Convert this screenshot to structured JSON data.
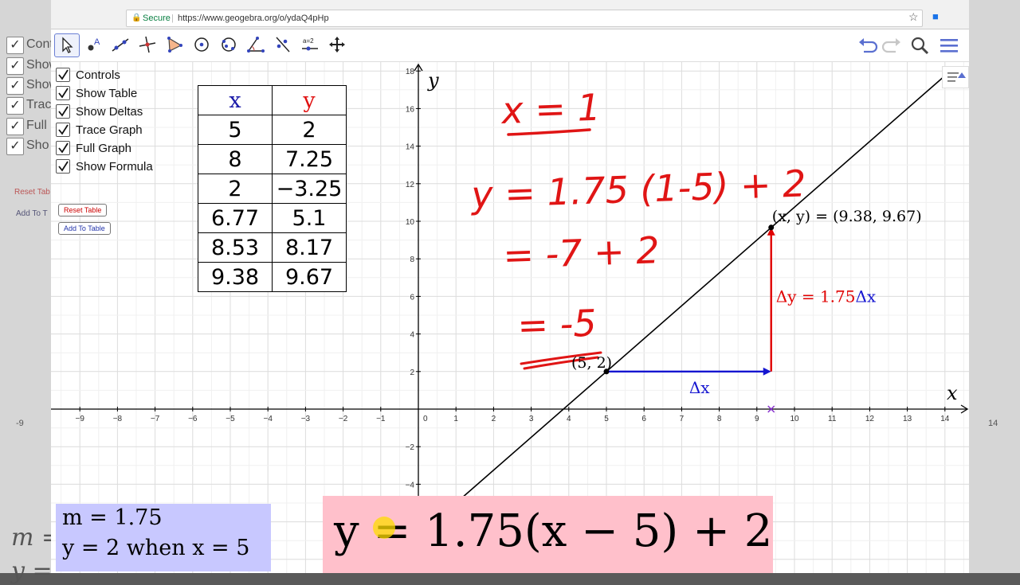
{
  "browser": {
    "secure_label": "Secure",
    "url": "https://www.geogebra.org/o/ydaQ4pHp"
  },
  "background": {
    "ghost_labels": [
      "Contro",
      "Show",
      "Show",
      "Trac",
      "Full",
      "Sho"
    ],
    "ghost_buttons": [
      "Reset Tab",
      "Add To T"
    ],
    "ghost_ticks": [
      "-9",
      "14"
    ],
    "ghost_letters": [
      "m =",
      "y ="
    ]
  },
  "controls": {
    "checkboxes": [
      {
        "label": "Controls",
        "checked": true
      },
      {
        "label": "Show Table",
        "checked": true
      },
      {
        "label": "Show Deltas",
        "checked": true
      },
      {
        "label": "Trace Graph",
        "checked": true
      },
      {
        "label": "Full Graph",
        "checked": true
      },
      {
        "label": "Show Formula",
        "checked": true
      }
    ],
    "reset_label": "Reset Table",
    "add_label": "Add To Table"
  },
  "table": {
    "headers": [
      "x",
      "y"
    ],
    "rows": [
      [
        "5",
        "2"
      ],
      [
        "8",
        "7.25"
      ],
      [
        "2",
        "−3.25"
      ],
      [
        "6.77",
        "5.1"
      ],
      [
        "8.53",
        "8.17"
      ],
      [
        "9.38",
        "9.67"
      ]
    ]
  },
  "info": {
    "line1": "m = 1.75",
    "line2": "y = 2 when x = 5"
  },
  "formula": "y = 1.75(x − 5) + 2",
  "graph": {
    "x_label": "x",
    "y_label": "y",
    "point_a_label": "(5, 2)",
    "point_b_label": "(x, y) = (9.38, 9.67)",
    "delta_y_prefix": "Δy = 1.75",
    "delta_y_suffix": "Δx",
    "delta_x_label": "Δx",
    "line": {
      "slope": 1.75,
      "x0": 5,
      "y0": 2
    },
    "point_a": [
      5,
      2
    ],
    "point_b": [
      9.38,
      9.67
    ],
    "x_ticks": [
      -9,
      -8,
      -7,
      -6,
      -5,
      -4,
      -3,
      -2,
      -1,
      0,
      1,
      2,
      3,
      4,
      5,
      6,
      7,
      8,
      9,
      10,
      11,
      12,
      13,
      14
    ],
    "y_ticks": [
      -4,
      -2,
      0,
      2,
      4,
      6,
      8,
      10,
      12,
      14,
      16,
      18
    ],
    "colors": {
      "delta_x": "#1515d0",
      "delta_y": "#e00000",
      "line": "#000000",
      "grid": "#e6e6e6"
    }
  },
  "handwriting": {
    "lines": [
      "x = 1",
      "y = 1.75 (1-5) + 2",
      "= -7 + 2",
      "= -5"
    ],
    "color": "#e01515"
  }
}
